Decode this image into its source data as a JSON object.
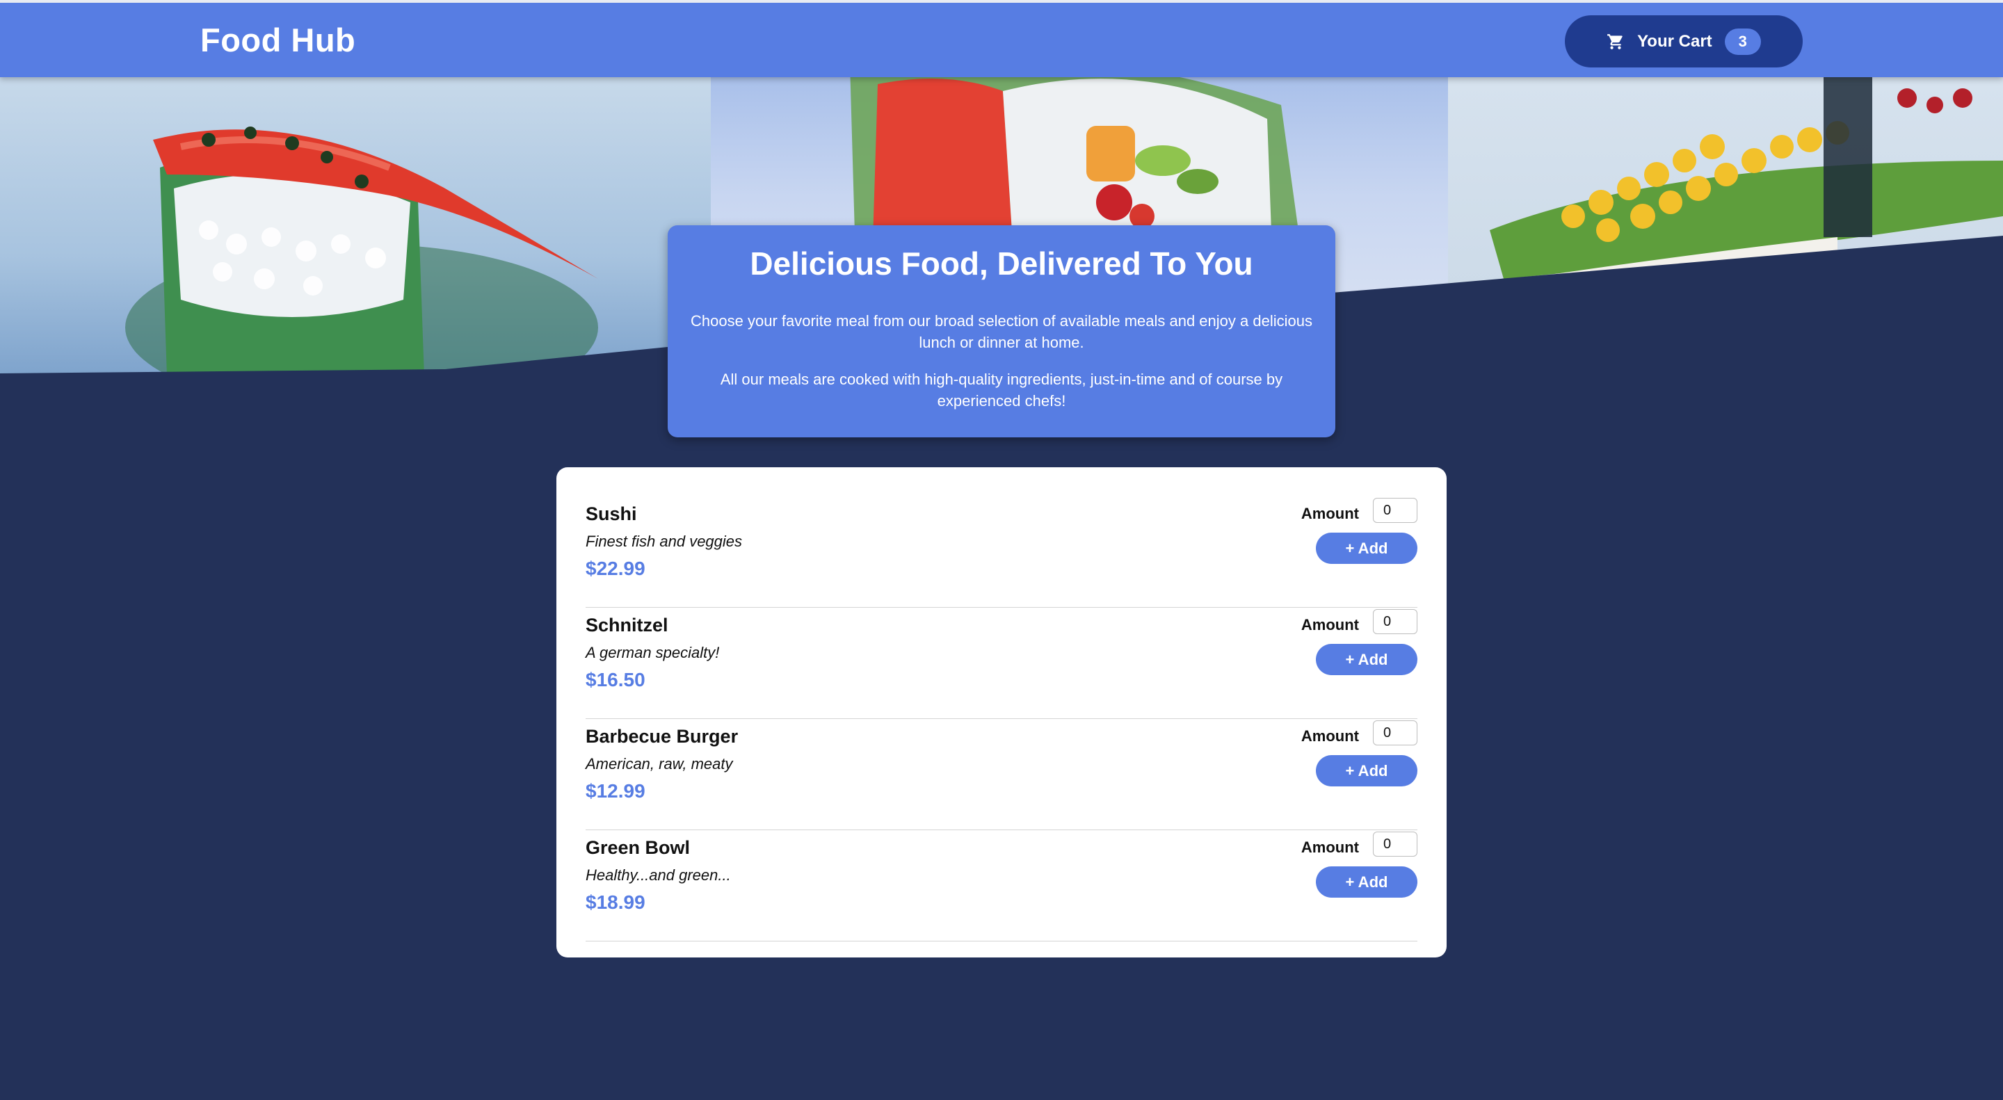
{
  "header": {
    "title": "Food Hub",
    "cart_label": "Your Cart",
    "cart_count": "3",
    "cart_icon": "shopping-cart-icon"
  },
  "intro": {
    "heading": "Delicious Food, Delivered To You",
    "paragraph_1": "Choose your favorite meal from our broad selection of available meals and enjoy a delicious lunch or dinner at home.",
    "paragraph_2": "All our meals are cooked with high-quality ingredients, just-in-time and of course by experienced chefs!"
  },
  "meals": [
    {
      "name": "Sushi",
      "description": "Finest fish and veggies",
      "price": "$22.99",
      "amount_label": "Amount",
      "amount": "0",
      "add_label": "+ Add"
    },
    {
      "name": "Schnitzel",
      "description": "A german specialty!",
      "price": "$16.50",
      "amount_label": "Amount",
      "amount": "0",
      "add_label": "+ Add"
    },
    {
      "name": "Barbecue Burger",
      "description": "American, raw, meaty",
      "price": "$12.99",
      "amount_label": "Amount",
      "amount": "0",
      "add_label": "+ Add"
    },
    {
      "name": "Green Bowl",
      "description": "Healthy...and green...",
      "price": "$18.99",
      "amount_label": "Amount",
      "amount": "0",
      "add_label": "+ Add"
    }
  ],
  "colors": {
    "accent": "#577de3",
    "background": "#233159",
    "cart_button": "#1f3b8f"
  }
}
